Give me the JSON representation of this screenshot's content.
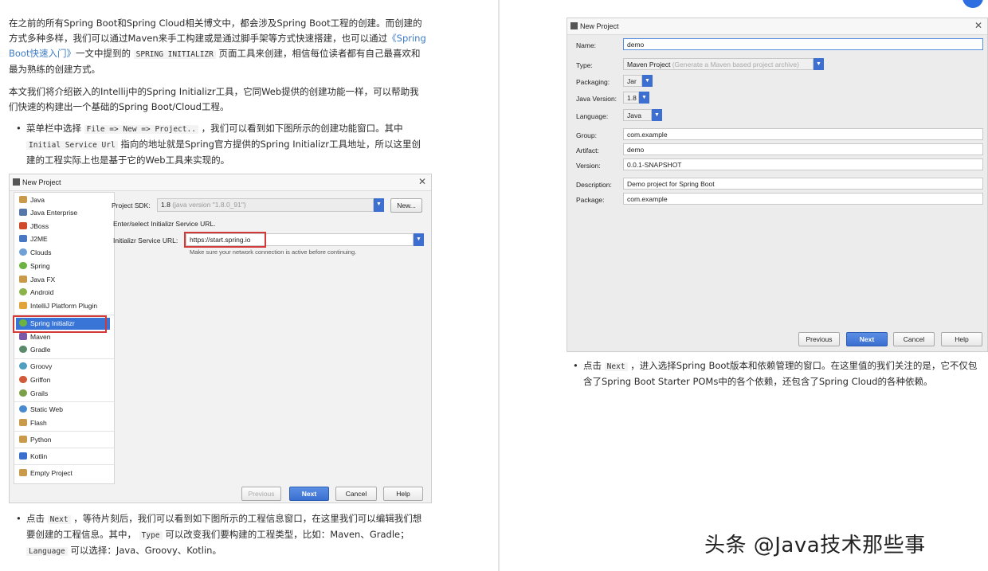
{
  "left": {
    "para1_a": "在之前的所有Spring Boot和Spring Cloud相关博文中，都会涉及Spring Boot工程的创建。而创建的方式多种多样，我们可以通过Maven来手工构建或是通过脚手架等方式快速搭建，也可以通过",
    "para1_link": "《Spring Boot快速入门》",
    "para1_b": "一文中提到的",
    "para1_code": "SPRING INITIALIZR",
    "para1_c": "页面工具来创建，相信每位读者都有自己最喜欢和最为熟练的创建方式。",
    "para2": "本文我们将介绍嵌入的Intellij中的Spring Initializr工具，它同Web提供的创建功能一样，可以帮助我们快速的构建出一个基础的Spring Boot/Cloud工程。",
    "bullet1_a": "菜单栏中选择",
    "bullet1_code1": "File => New => Project..",
    "bullet1_b": "，我们可以看到如下图所示的创建功能窗口。其中",
    "bullet1_code2": "Initial Service Url",
    "bullet1_c": "指向的地址就是Spring官方提供的Spring Initializr工具地址，所以这里创建的工程实际上也是基于它的Web工具来实现的。",
    "bullet2_a": "点击",
    "bullet2_code1": "Next",
    "bullet2_b": "，等待片刻后，我们可以看到如下图所示的工程信息窗口，在这里我们可以编辑我们想要创建的工程信息。其中，",
    "bullet2_code2": "Type",
    "bullet2_c": "可以改变我们要构建的工程类型，比如：Maven、Gradle；",
    "bullet2_code3": "Language",
    "bullet2_d": "可以选择：Java、Groovy、Kotlin。",
    "dialog": {
      "title": "New Project",
      "sidebar": [
        "Java",
        "Java Enterprise",
        "JBoss",
        "J2ME",
        "Clouds",
        "Spring",
        "Java FX",
        "Android",
        "IntelliJ Platform Plugin",
        "Spring Initializr",
        "Maven",
        "Gradle",
        "Groovy",
        "Griffon",
        "Grails",
        "Static Web",
        "Flash",
        "Python",
        "Kotlin",
        "Empty Project"
      ],
      "sdk_label": "Project SDK:",
      "sdk_value": "1.8",
      "sdk_detail": "(java version \"1.8.0_91\")",
      "new_button": "New...",
      "enter_select": "Enter/select Initializr Service URL.",
      "url_label": "Initializr Service URL:",
      "url_value": "https://start.spring.io",
      "hint": "Make sure your network connection is active before continuing.",
      "buttons": {
        "previous": "Previous",
        "next": "Next",
        "cancel": "Cancel",
        "help": "Help"
      }
    }
  },
  "right": {
    "dialog": {
      "title": "New Project",
      "name_label": "Name:",
      "name_value": "demo",
      "type_label": "Type:",
      "type_value": "Maven Project",
      "type_detail": "(Generate a Maven based project archive)",
      "packaging_label": "Packaging:",
      "packaging_value": "Jar",
      "java_label": "Java Version:",
      "java_value": "1.8",
      "language_label": "Language:",
      "language_value": "Java",
      "group_label": "Group:",
      "group_value": "com.example",
      "artifact_label": "Artifact:",
      "artifact_value": "demo",
      "version_label": "Version:",
      "version_value": "0.0.1-SNAPSHOT",
      "description_label": "Description:",
      "description_value": "Demo project for Spring Boot",
      "package_label": "Package:",
      "package_value": "com.example",
      "buttons": {
        "previous": "Previous",
        "next": "Next",
        "cancel": "Cancel",
        "help": "Help"
      }
    },
    "bullet_a": "点击",
    "bullet_code": "Next",
    "bullet_b": "，进入选择Spring Boot版本和依赖管理的窗口。在这里值的我们关注的是，它不仅包含了Spring Boot Starter POMs中的各个依赖，还包含了Spring Cloud的各种依赖。"
  },
  "watermark": "头条 @Java技术那些事",
  "colors": {
    "accent": "#3875d6",
    "link": "#3b7bc4",
    "highlight_box": "#d23a3a"
  }
}
